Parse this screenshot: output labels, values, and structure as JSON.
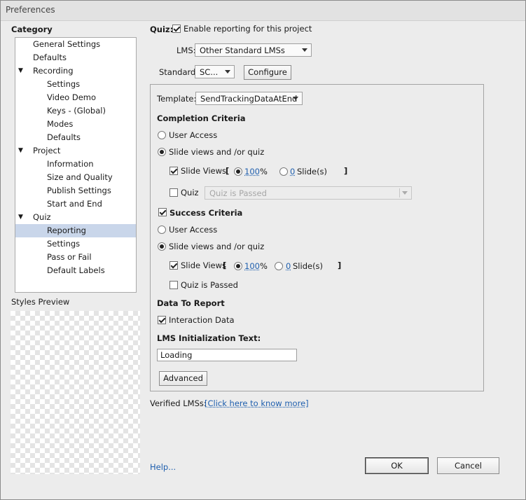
{
  "window": {
    "title": "Preferences"
  },
  "sidebar": {
    "heading": "Category",
    "items": [
      {
        "label": "General Settings",
        "level": 1,
        "expander": false,
        "selected": false
      },
      {
        "label": "Defaults",
        "level": 1,
        "expander": false,
        "selected": false
      },
      {
        "label": "Recording",
        "level": 1,
        "expander": true,
        "selected": false
      },
      {
        "label": "Settings",
        "level": 2,
        "expander": false,
        "selected": false
      },
      {
        "label": "Video Demo",
        "level": 2,
        "expander": false,
        "selected": false
      },
      {
        "label": "Keys - (Global)",
        "level": 2,
        "expander": false,
        "selected": false
      },
      {
        "label": "Modes",
        "level": 2,
        "expander": false,
        "selected": false
      },
      {
        "label": "Defaults",
        "level": 2,
        "expander": false,
        "selected": false
      },
      {
        "label": "Project",
        "level": 1,
        "expander": true,
        "selected": false
      },
      {
        "label": "Information",
        "level": 2,
        "expander": false,
        "selected": false
      },
      {
        "label": "Size and Quality",
        "level": 2,
        "expander": false,
        "selected": false
      },
      {
        "label": "Publish Settings",
        "level": 2,
        "expander": false,
        "selected": false
      },
      {
        "label": "Start and End",
        "level": 2,
        "expander": false,
        "selected": false
      },
      {
        "label": "Quiz",
        "level": 1,
        "expander": true,
        "selected": false
      },
      {
        "label": "Reporting",
        "level": 2,
        "expander": false,
        "selected": true
      },
      {
        "label": "Settings",
        "level": 2,
        "expander": false,
        "selected": false
      },
      {
        "label": "Pass or Fail",
        "level": 2,
        "expander": false,
        "selected": false
      },
      {
        "label": "Default Labels",
        "level": 2,
        "expander": false,
        "selected": false
      }
    ],
    "styles_preview_label": "Styles Preview"
  },
  "main": {
    "quiz_label": "Quiz:",
    "enable_reporting": {
      "label": "Enable reporting for this project",
      "checked": true
    },
    "lms": {
      "label": "LMS:",
      "value": "Other Standard LMSs"
    },
    "standard": {
      "label": "Standard:",
      "value": "SC...",
      "configure_label": "Configure"
    },
    "template": {
      "label": "Template:",
      "value": "SendTrackingDataAtEnd"
    },
    "completion": {
      "heading": "Completion Criteria",
      "user_access": {
        "label": "User Access",
        "checked": false
      },
      "slide_views_or_quiz": {
        "label": "Slide views and /or quiz",
        "checked": true
      },
      "slide_views": {
        "label": "Slide Views",
        "checked": true,
        "bracket_open": "[",
        "bracket_close": "]",
        "percent_value": "100",
        "percent_unit": "%",
        "percent_checked": true,
        "slides_value": "0",
        "slides_unit": "Slide(s)",
        "slides_checked": false
      },
      "quiz": {
        "label": "Quiz",
        "checked": false,
        "dropdown_value": "Quiz is Passed"
      }
    },
    "success": {
      "heading": "Success Criteria",
      "checked": true,
      "user_access": {
        "label": "User Access",
        "checked": false
      },
      "slide_views_or_quiz": {
        "label": "Slide views and /or quiz",
        "checked": true
      },
      "slide_views": {
        "label": "Slide Views",
        "checked": true,
        "bracket_open": "[",
        "bracket_close": "]",
        "percent_value": "100",
        "percent_unit": "%",
        "percent_checked": true,
        "slides_value": "0",
        "slides_unit": "Slide(s)",
        "slides_checked": false
      },
      "quiz_passed": {
        "label": "Quiz is Passed",
        "checked": false
      }
    },
    "data_to_report": {
      "heading": "Data To Report",
      "interaction_data": {
        "label": "Interaction Data",
        "checked": true
      }
    },
    "lms_init": {
      "heading": "LMS Initialization Text:",
      "value": "Loading"
    },
    "advanced_label": "Advanced",
    "verified": {
      "label": "Verified LMSs:",
      "link_text": "[Click here to know more]"
    }
  },
  "footer": {
    "help_label": "Help...",
    "ok_label": "OK",
    "cancel_label": "Cancel"
  }
}
